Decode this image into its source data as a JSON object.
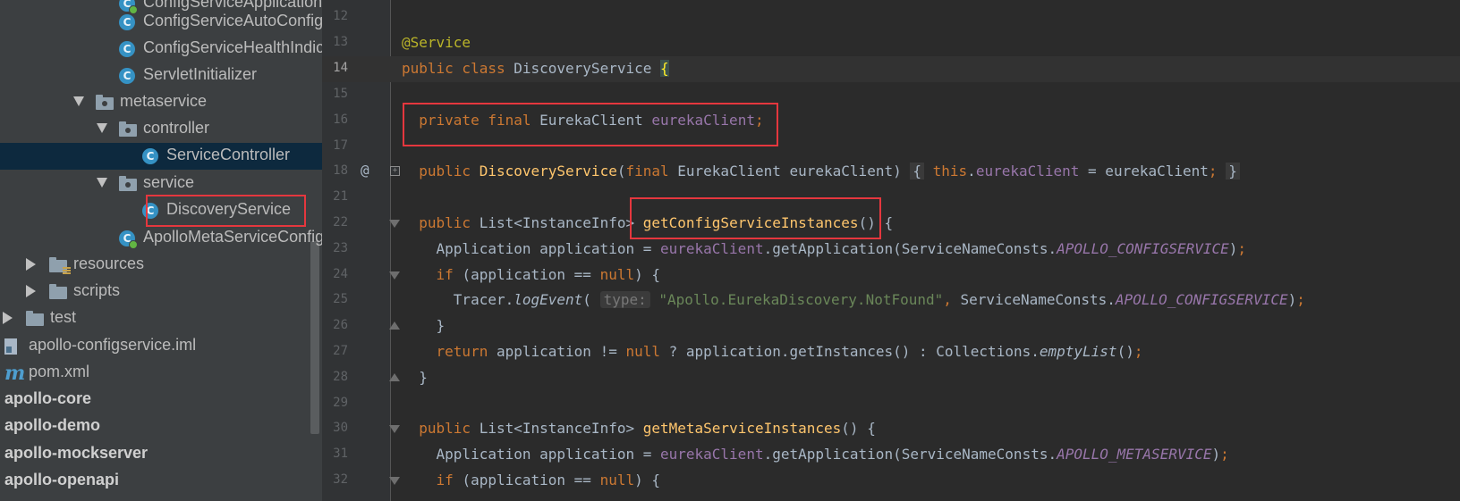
{
  "project_tree": {
    "items": [
      {
        "label": "ConfigServiceApplication",
        "type": "class-spring",
        "arrow": ""
      },
      {
        "label": "ConfigServiceAutoConfiguration",
        "type": "class",
        "arrow": ""
      },
      {
        "label": "ConfigServiceHealthIndicator",
        "type": "class",
        "arrow": ""
      },
      {
        "label": "ServletInitializer",
        "type": "class",
        "arrow": ""
      },
      {
        "label": "metaservice",
        "type": "package",
        "arrow": "down"
      },
      {
        "label": "controller",
        "type": "package",
        "arrow": "down"
      },
      {
        "label": "ServiceController",
        "type": "class",
        "arrow": ""
      },
      {
        "label": "service",
        "type": "package",
        "arrow": "down"
      },
      {
        "label": "DiscoveryService",
        "type": "class",
        "arrow": ""
      },
      {
        "label": "ApolloMetaServiceConfig",
        "type": "class-spring",
        "arrow": ""
      },
      {
        "label": "resources",
        "type": "resources-folder",
        "arrow": "right"
      },
      {
        "label": "scripts",
        "type": "folder",
        "arrow": "right"
      },
      {
        "label": "test",
        "type": "folder",
        "arrow": "right"
      },
      {
        "label": "apollo-configservice.iml",
        "type": "iml",
        "arrow": ""
      },
      {
        "label": "pom.xml",
        "type": "maven",
        "arrow": ""
      },
      {
        "label": "apollo-core",
        "type": "module",
        "arrow": ""
      },
      {
        "label": "apollo-demo",
        "type": "module",
        "arrow": ""
      },
      {
        "label": "apollo-mockserver",
        "type": "module",
        "arrow": ""
      },
      {
        "label": "apollo-openapi",
        "type": "module",
        "arrow": ""
      }
    ]
  },
  "editor": {
    "lines": [
      {
        "num": "12",
        "html": ""
      },
      {
        "num": "13",
        "html": "<span class=\"ann\">@Service</span>"
      },
      {
        "num": "14",
        "html": "<span class=\"kw\">public class </span>DiscoveryService <span class=\"braceHL\">{</span>",
        "current": true
      },
      {
        "num": "15",
        "html": ""
      },
      {
        "num": "16",
        "html": "  <span class=\"kw\">private final </span>EurekaClient <span class=\"fld\">eurekaClient</span><span class=\"kw\">;</span>"
      },
      {
        "num": "17",
        "html": ""
      },
      {
        "num": "18",
        "html": "  <span class=\"kw\">public </span><span class=\"fn\">DiscoveryService</span>(<span class=\"kw\">final </span>EurekaClient eurekaClient) <span class=\"foldBox\">{</span> <span class=\"kw\">this</span>.<span class=\"fld\">eurekaClient</span> = eurekaClient<span class=\"kw\">;</span> <span class=\"foldBox\">}</span>",
        "mark": "@",
        "fold": "box"
      },
      {
        "num": "21",
        "html": ""
      },
      {
        "num": "22",
        "html": "  <span class=\"kw\">public </span>List&lt;InstanceInfo&gt; <span class=\"fn\">getConfigServiceInstances</span>() {",
        "fold": "tri"
      },
      {
        "num": "23",
        "html": "    Application application = <span class=\"fld\">eurekaClient</span>.getApplication(ServiceNameConsts.<span class=\"fld it\">APOLLO_CONFIGSERVICE</span>)<span class=\"kw\">;</span>"
      },
      {
        "num": "24",
        "html": "    <span class=\"kw\">if </span>(application == <span class=\"kw\">null</span>) {",
        "fold": "tri"
      },
      {
        "num": "25",
        "html": "      Tracer.<span class=\"it\">logEvent</span>( <span class=\"hint\">type:</span> <span class=\"str\">\"Apollo.EurekaDiscovery.NotFound\"</span><span class=\"kw\">, </span>ServiceNameConsts.<span class=\"fld it\">APOLLO_CONFIGSERVICE</span>)<span class=\"kw\">;</span>"
      },
      {
        "num": "26",
        "html": "    }",
        "fold": "end"
      },
      {
        "num": "27",
        "html": "    <span class=\"kw\">return </span>application != <span class=\"kw\">null </span>? application.getInstances() : Collections.<span class=\"it\">emptyList</span>()<span class=\"kw\">;</span>"
      },
      {
        "num": "28",
        "html": "  }",
        "fold": "end"
      },
      {
        "num": "29",
        "html": ""
      },
      {
        "num": "30",
        "html": "  <span class=\"kw\">public </span>List&lt;InstanceInfo&gt; <span class=\"fn\">getMetaServiceInstances</span>() {",
        "fold": "tri"
      },
      {
        "num": "31",
        "html": "    Application application = <span class=\"fld\">eurekaClient</span>.getApplication(ServiceNameConsts.<span class=\"fld it\">APOLLO_METASERVICE</span>)<span class=\"kw\">;</span>"
      },
      {
        "num": "32",
        "html": "    <span class=\"kw\">if </span>(application == <span class=\"kw\">null</span>) {",
        "fold": "tri"
      }
    ]
  },
  "colors": {
    "highlight_border": "#e5373e",
    "tree_background": "#3c3f41",
    "editor_background": "#2b2b2b",
    "selection": "#0d293e"
  }
}
